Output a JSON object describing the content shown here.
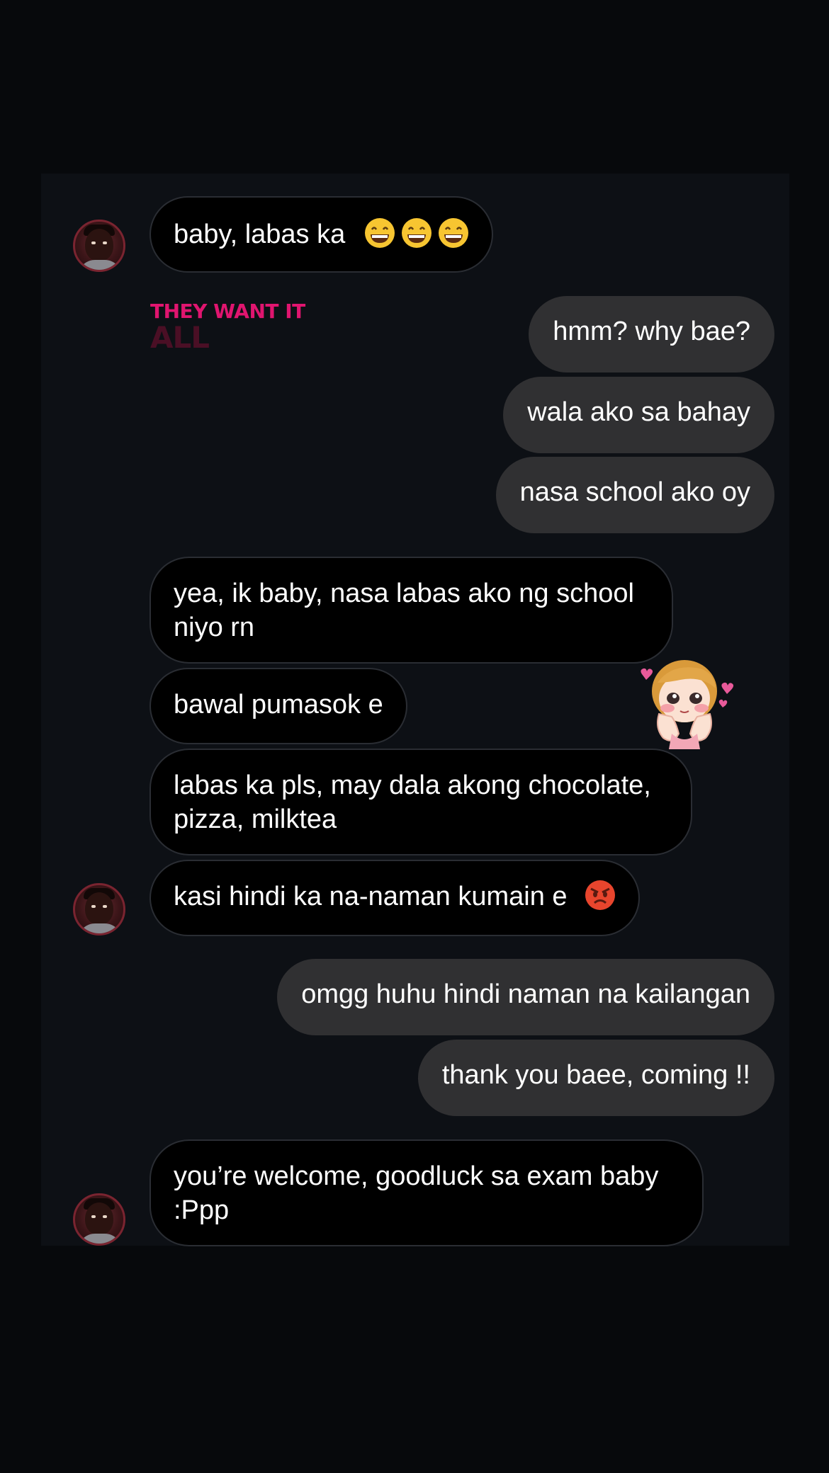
{
  "messages": [
    {
      "text": "baby, labas ka",
      "emojis": [
        "grinning-face",
        "grinning-face",
        "grinning-face"
      ]
    },
    {
      "text": "hmm? why bae?"
    },
    {
      "text": "wala ako sa bahay"
    },
    {
      "text": "nasa school ako oy"
    },
    {
      "text": "yea, ik baby, nasa labas ako ng school niyo rn"
    },
    {
      "text": "bawal pumasok e"
    },
    {
      "text": "labas ka pls, may dala akong chocolate, pizza, milktea"
    },
    {
      "text": "kasi hindi ka na-naman kumain e",
      "emojis": [
        "angry-face"
      ]
    },
    {
      "text": "omgg huhu hindi naman na kailangan"
    },
    {
      "text": "thank you baee, coming !!"
    },
    {
      "text": "you’re welcome, goodluck sa exam baby :Ppp"
    }
  ],
  "ad": {
    "line1": "THEY WANT IT",
    "line2": "ALL",
    "colors": {
      "line1": "#e0156f",
      "line2": "#4a0f25"
    }
  },
  "sticker": {
    "icon": "blushing-girl-sticker"
  },
  "colors": {
    "background": "#07090c",
    "chat_panel": "#0d1015",
    "incoming_bubble": "#000000",
    "outgoing_bubble": "#303032"
  }
}
